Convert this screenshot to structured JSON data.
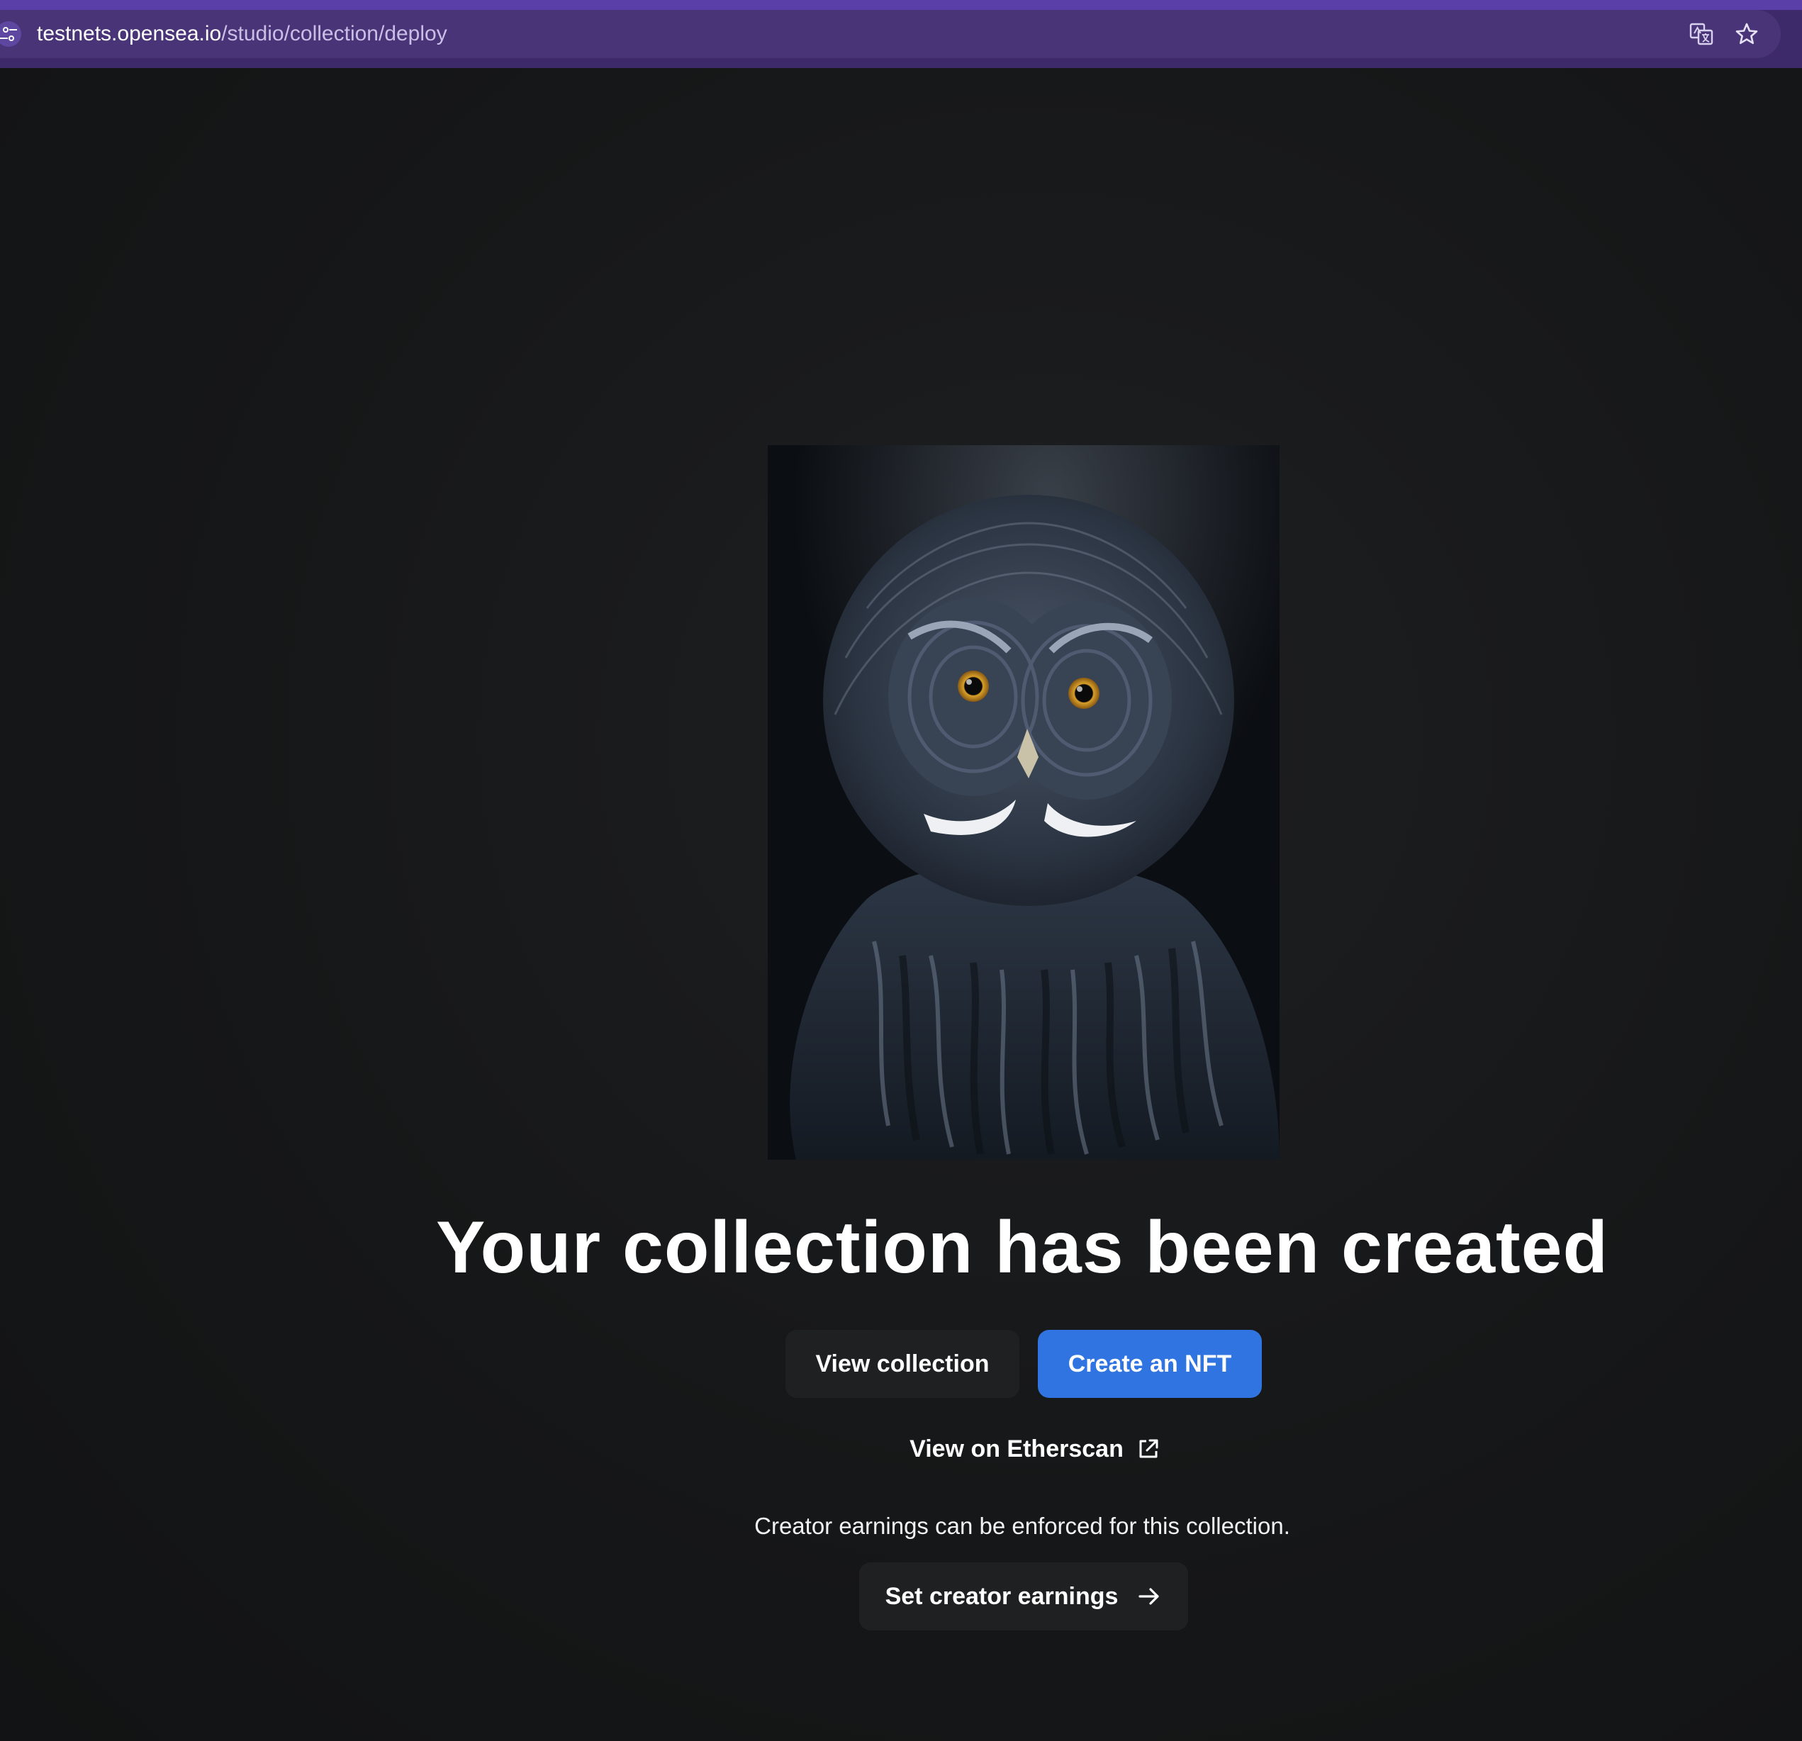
{
  "browser": {
    "url_host": "testnets.opensea.io",
    "url_path": "/studio/collection/deploy",
    "icons": [
      "site-settings-icon",
      "translate-icon",
      "star-icon"
    ]
  },
  "main": {
    "image_alt": "Owl",
    "headline": "Your collection has been created",
    "view_collection_label": "View collection",
    "create_nft_label": "Create an NFT",
    "etherscan_label": "View on Etherscan",
    "earnings_note": "Creator earnings can be enforced for this collection.",
    "set_earnings_label": "Set creator earnings"
  },
  "colors": {
    "accent": "#2f74e0",
    "browser_bar": "#4a3478",
    "background": "#141516",
    "secondary_button": "#1f2022"
  }
}
